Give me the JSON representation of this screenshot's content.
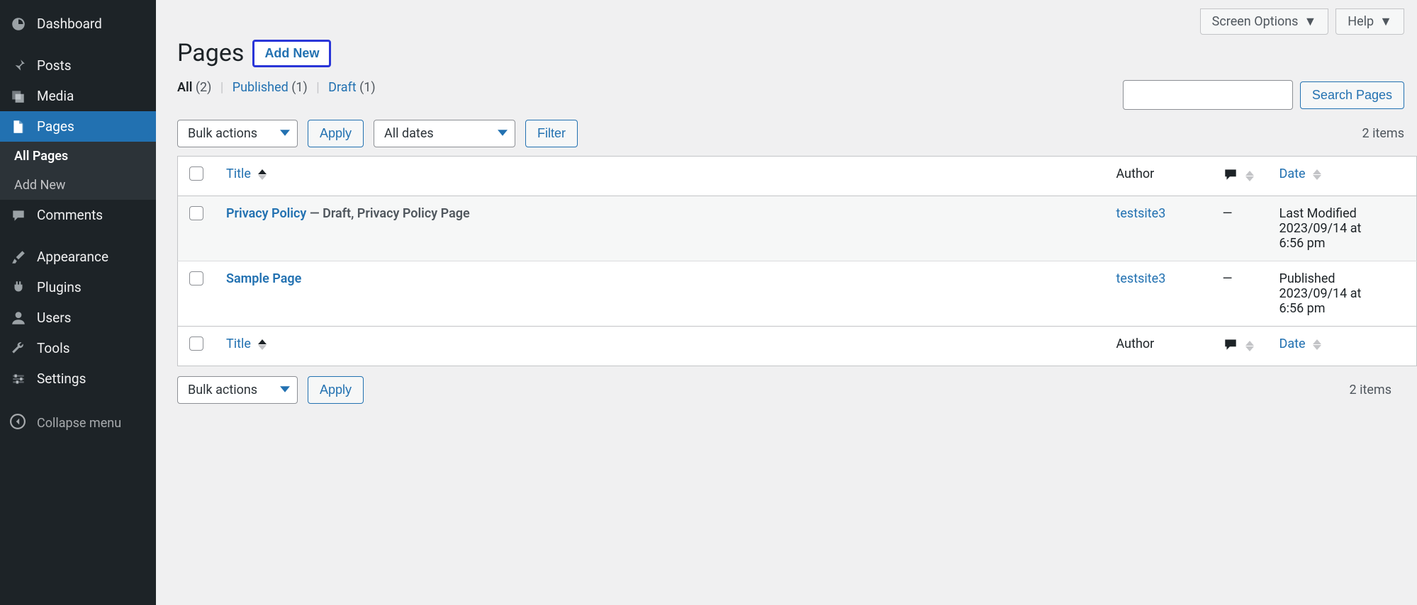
{
  "sidebar": {
    "items": [
      {
        "label": "Dashboard",
        "icon": "dashboard-icon"
      },
      {
        "label": "Posts",
        "icon": "pin-icon"
      },
      {
        "label": "Media",
        "icon": "media-icon"
      },
      {
        "label": "Pages",
        "icon": "page-icon"
      },
      {
        "label": "Comments",
        "icon": "comment-icon"
      },
      {
        "label": "Appearance",
        "icon": "brush-icon"
      },
      {
        "label": "Plugins",
        "icon": "plug-icon"
      },
      {
        "label": "Users",
        "icon": "user-icon"
      },
      {
        "label": "Tools",
        "icon": "wrench-icon"
      },
      {
        "label": "Settings",
        "icon": "sliders-icon"
      }
    ],
    "submenu": {
      "all_pages": "All Pages",
      "add_new": "Add New"
    },
    "collapse": "Collapse menu"
  },
  "topbar": {
    "screen_options": "Screen Options",
    "help": "Help"
  },
  "header": {
    "title": "Pages",
    "add_new": "Add New"
  },
  "filters": {
    "all_label": "All",
    "all_count": "(2)",
    "published_label": "Published",
    "published_count": "(1)",
    "draft_label": "Draft",
    "draft_count": "(1)"
  },
  "controls": {
    "bulk_actions": "Bulk actions",
    "apply": "Apply",
    "all_dates": "All dates",
    "filter": "Filter",
    "items_count": "2 items",
    "search_pages": "Search Pages"
  },
  "table": {
    "cols": {
      "title": "Title",
      "author": "Author",
      "date": "Date"
    },
    "rows": [
      {
        "title": "Privacy Policy",
        "meta": " — Draft, Privacy Policy Page",
        "author": "testsite3",
        "comments": "—",
        "date_line1": "Last Modified",
        "date_line2": "2023/09/14 at",
        "date_line3": "6:56 pm",
        "draft": true
      },
      {
        "title": "Sample Page",
        "meta": "",
        "author": "testsite3",
        "comments": "—",
        "date_line1": "Published",
        "date_line2": "2023/09/14 at",
        "date_line3": "6:56 pm",
        "draft": false
      }
    ]
  }
}
